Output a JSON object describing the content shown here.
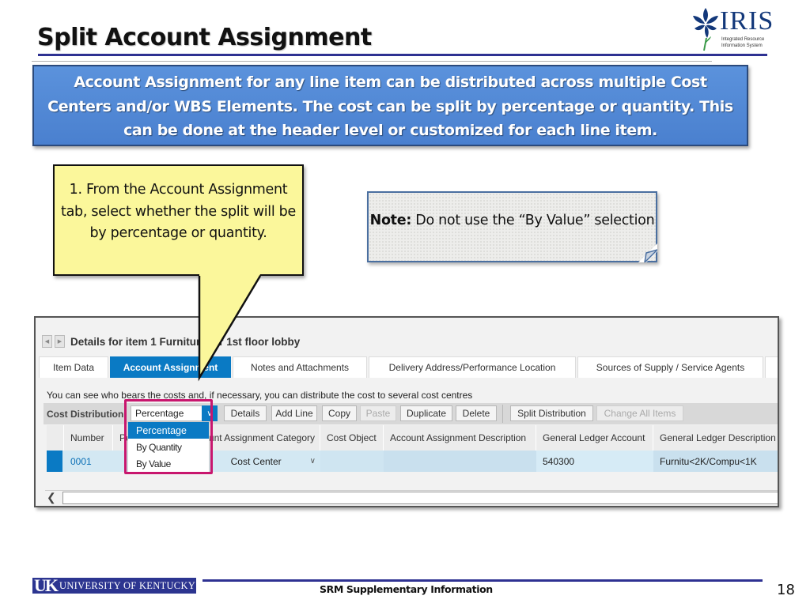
{
  "slide": {
    "title": "Split Account Assignment",
    "logo": {
      "word": "IRIS",
      "subtitle_line1": "Integrated Resource",
      "subtitle_line2": "Information System"
    },
    "banner_lines": [
      "Account Assignment for any line item can be distributed across multiple Cost",
      "Centers and/or WBS Elements. The cost can be split by percentage or quantity. This",
      "can be done at the header level or customized for each line item."
    ],
    "callout_text": "1. From the Account Assignment tab, select whether the split will be by percentage or quantity.",
    "note": {
      "label": "Note:",
      "text": " Do not use the “By Value” selection"
    },
    "footer": {
      "org_abbr": "UK",
      "org_name": "UNIVERSITY OF KENTUCKY",
      "center_text": "SRM Supplementary Information",
      "page_number": "18"
    }
  },
  "sap": {
    "details_title": "Details for item 1  Furniture for 1st floor lobby",
    "tabs": [
      {
        "label": "Item Data",
        "active": false
      },
      {
        "label": "Account Assignment",
        "active": true
      },
      {
        "label": "Notes and Attachments",
        "active": false
      },
      {
        "label": "Delivery Address/Performance Location",
        "active": false
      },
      {
        "label": "Sources of Supply / Service Agents",
        "active": false
      }
    ],
    "info_text": "You can see who bears the costs and, if necessary, you can distribute the cost to several cost centres",
    "toolbar": {
      "cost_distribution_label": "Cost Distribution",
      "selected_value": "Percentage",
      "buttons": [
        {
          "label": "Details",
          "enabled": true
        },
        {
          "label": "Add Line",
          "enabled": true
        },
        {
          "label": "Copy",
          "enabled": true
        },
        {
          "label": "Paste",
          "enabled": false
        },
        {
          "label": "Duplicate",
          "enabled": true
        },
        {
          "label": "Delete",
          "enabled": true
        },
        {
          "label": "Split Distribution",
          "enabled": true
        },
        {
          "label": "Change All Items",
          "enabled": false
        }
      ]
    },
    "dropdown_options": [
      {
        "label": "Percentage",
        "selected": true
      },
      {
        "label": "By Quantity",
        "selected": false
      },
      {
        "label": "By Value",
        "selected": false
      }
    ],
    "grid": {
      "columns": [
        "Number",
        "Percentage",
        "Account Assignment Category",
        "Cost Object",
        "Account Assignment Description",
        "General Ledger Account",
        "General Ledger Description"
      ],
      "rows": [
        {
          "number": "0001",
          "percentage": "",
          "category": "Cost Center",
          "cost_object": "",
          "description": "",
          "gl_account": "540300",
          "gl_description": "Furnitu<2K/Compu<1K"
        }
      ]
    },
    "colors": {
      "accent": "#0a7ac4",
      "highlight_border": "#c8166e",
      "row_background": "#d3e8f3"
    }
  }
}
